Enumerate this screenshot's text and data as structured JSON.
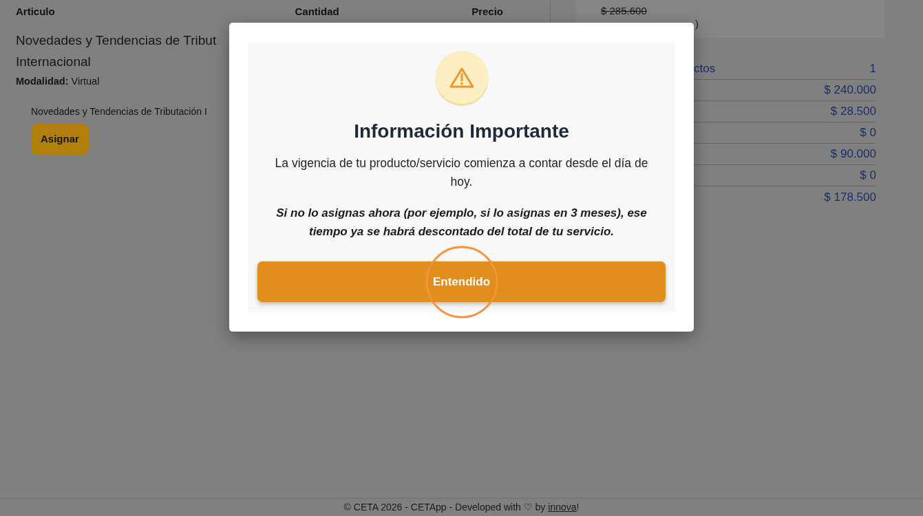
{
  "cart_table": {
    "columns": [
      "Articulo",
      "Cantidad",
      "Precio"
    ],
    "rows": [
      {
        "title_lines": [
          "Novedades y Tendencias de Tribut",
          "Internacional"
        ],
        "modality": "**Modalidad:** Virtual",
        "assigned_item": "Novedades y Tendencias de Tributación I",
        "assign_button": "Asignar"
      }
    ]
  },
  "summary": {
    "original_price": "$ 285.600",
    "original_price_struck": true,
    "note": ")",
    "rows": [
      {
        "label": "ctos",
        "value": "1"
      },
      {
        "value": "$ 240.000"
      },
      {
        "value": "$ 28.500"
      },
      {
        "value": "$ 0"
      },
      {
        "value": "$ 90.000"
      },
      {
        "value": "$ 0"
      },
      {
        "value": "$ 178.500"
      }
    ]
  },
  "modal": {
    "title": "Información Importante",
    "message": "La vigencia de tu producto/servicio comienza a contar desde el día de hoy.",
    "warning": "Si no lo asignas ahora (por ejemplo, si lo asignas en 3 meses), ese tiempo ya se habrá descontado del total de tu servicio.",
    "button": {
      "label": "Entendido",
      "highlighted": true
    }
  },
  "footer": {
    "text_before": "© CETA 2026 - CETApp - Developed with ♡ by ",
    "link": "innova",
    "text_after": "!"
  }
}
